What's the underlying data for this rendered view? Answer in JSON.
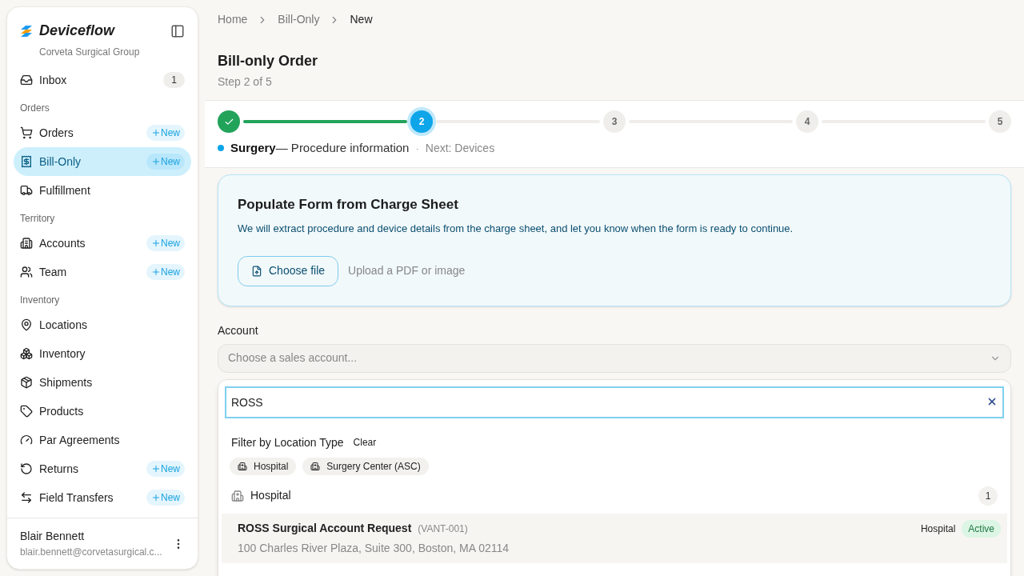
{
  "sidebar": {
    "brand": "Deviceflow",
    "org": "Corveta Surgical Group",
    "sections": [
      {
        "items": [
          {
            "label": "Inbox",
            "selected": false,
            "count": "1"
          }
        ]
      },
      {
        "heading": "Orders",
        "items": [
          {
            "label": "Orders",
            "selected": false,
            "new_label": "New"
          },
          {
            "label": "Bill-Only",
            "selected": true,
            "new_label": "New"
          },
          {
            "label": "Fulfillment",
            "selected": false
          }
        ]
      },
      {
        "heading": "Territory",
        "items": [
          {
            "label": "Accounts",
            "selected": false,
            "new_label": "New"
          },
          {
            "label": "Team",
            "selected": false,
            "new_label": "New"
          }
        ]
      },
      {
        "heading": "Inventory",
        "items": [
          {
            "label": "Locations",
            "selected": false
          },
          {
            "label": "Inventory",
            "selected": false
          },
          {
            "label": "Shipments",
            "selected": false
          },
          {
            "label": "Products",
            "selected": false
          },
          {
            "label": "Par Agreements",
            "selected": false
          },
          {
            "label": "Returns",
            "selected": false,
            "new_label": "New"
          },
          {
            "label": "Field Transfers",
            "selected": false,
            "new_label": "New"
          }
        ]
      }
    ],
    "user": {
      "name": "Blair Bennett",
      "email": "blair.bennett@corvetasurgical.c..."
    }
  },
  "breadcrumb": [
    "Home",
    "Bill-Only",
    "New"
  ],
  "page": {
    "title": "Bill-only Order",
    "subtitle": "Step 2 of 5"
  },
  "stepper": {
    "steps": [
      {
        "done": true,
        "current": false
      },
      {
        "number": "2",
        "done": false,
        "current": true
      },
      {
        "number": "3",
        "done": false,
        "current": false
      },
      {
        "number": "4",
        "done": false,
        "current": false
      },
      {
        "number": "5",
        "done": false,
        "current": false
      }
    ],
    "current_name": "Surgery",
    "current_desc": "— Procedure information",
    "separator": "·",
    "next": "Next: Devices"
  },
  "charge_sheet": {
    "title": "Populate Form from Charge Sheet",
    "description": "We will extract procedure and device details from the charge sheet, and let you know when the form is ready to continue.",
    "button": "Choose file",
    "hint": "Upload a PDF or image"
  },
  "account": {
    "label": "Account",
    "placeholder": "Choose a sales account...",
    "expanded": true,
    "dropdown": {
      "search": "ROSS",
      "filter_label": "Filter by Location Type",
      "clear": "Clear",
      "filters": [
        {
          "label": "Hospital",
          "selected": false
        },
        {
          "label": "Surgery Center (ASC)",
          "selected": false
        }
      ],
      "groups": [
        {
          "name": "Hospital",
          "count": "1",
          "results": [
            {
              "name": "ROSS Surgical Account Request",
              "code": "(VANT-001)",
              "address": "100 Charles River Plaza, Suite 300, Boston, MA 02114",
              "type": "Hospital",
              "status": "Active",
              "highlighted": true
            }
          ]
        }
      ]
    }
  }
}
